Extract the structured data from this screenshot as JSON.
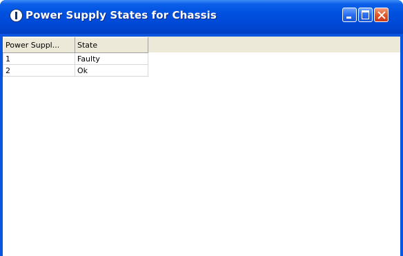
{
  "window": {
    "title": "Power Supply States for Chassis",
    "icon": "info-circle-icon",
    "controls": {
      "minimize": "minimize-icon",
      "maximize": "maximize-icon",
      "close": "close-icon"
    }
  },
  "table": {
    "columns": [
      "Power Suppl...",
      "State"
    ],
    "rows": [
      [
        "1",
        "Faulty"
      ],
      [
        "2",
        "Ok"
      ]
    ]
  },
  "colors": {
    "titlebar": "#0050e0",
    "close_button": "#e25a2a",
    "header_background": "#ece9d8"
  }
}
